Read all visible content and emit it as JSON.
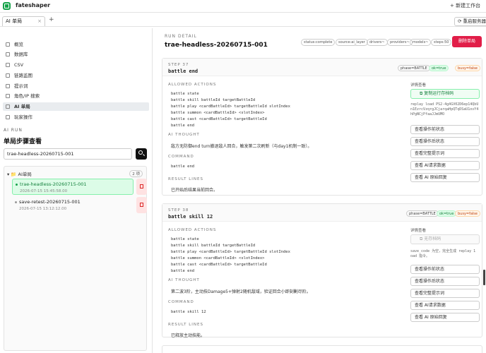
{
  "app": {
    "brand": "fateshaper",
    "new_workspace": "+ 新建工作台"
  },
  "tabs": [
    {
      "label": "AI 单局",
      "close": "×"
    }
  ],
  "tab_add": "+",
  "refresh_label": "重启服务器",
  "sidebar": {
    "items": [
      {
        "label": "概览"
      },
      {
        "label": "数据库"
      },
      {
        "label": "CSV"
      },
      {
        "label": "链路监图"
      },
      {
        "label": "提示词"
      },
      {
        "label": "角色/IP 搜索"
      },
      {
        "label": "AI 单局"
      },
      {
        "label": "玩家操作"
      }
    ],
    "active_index": 6
  },
  "ai_run": {
    "section_label": "AI RUN",
    "title": "单局步骤查看",
    "search_value": "trae-headless-20260715-001",
    "folder": {
      "name": "AI单局",
      "count": "2 项"
    },
    "runs": [
      {
        "name": "trae-headless-20260715-001",
        "time": "2026-07-15 15:45:58.00"
      },
      {
        "name": "save-retest-20260715-001",
        "time": "2026-07-15 13:12:12.00"
      }
    ]
  },
  "run_detail": {
    "section_label": "RUN DETAIL",
    "title": "trae-headless-20260715-001",
    "chips": [
      "status:complete",
      "source:ai_layer",
      "drivers~",
      "providers~",
      "models~",
      "steps:50"
    ],
    "delete_label": "删除单局"
  },
  "labels": {
    "allowed": "ALLOWED ACTIONS",
    "thought": "AI THOUGHT",
    "command": "COMMAND",
    "result": "RESULT LINES",
    "detail": "详情查看",
    "actions": [
      "查看操作前状态",
      "查看操作后状态",
      "查看完整提示词",
      "查看 AI请求数据",
      "查看 AI 原始回复"
    ]
  },
  "steps": [
    {
      "label": "STEP 37",
      "title": "battle end",
      "badges": [
        "phase=BATTLE",
        "ok=true",
        "busy=false"
      ],
      "allowed": [
        "battle state",
        "battle skill battleId targetBattleId",
        "battle play <cardBattleId> targetBattleId slotIndex",
        "battle summon <cardBattleId> <slotIndex>",
        "battle cast <cardBattleId> targetBattleId",
        "battle end"
      ],
      "thought": "敌方无防御end turn撤退敌人回合，触发第二次刷新（与day1机制一致）。",
      "command": "battle end",
      "result": "已开始后结果当前回合。",
      "copy_label": "复制运行存档码",
      "replay": "replay load PS2-4g4GV02D6ep14QbUn1EzrcVzqrgJCjarqaHpQTqDSaU1ovY4hPgNCjPfaaJJmUMO"
    },
    {
      "label": "STEP 38",
      "title": "battle skill 12",
      "badges": [
        "phase=BATTLE",
        "ok=true",
        "busy=false"
      ],
      "allowed": [
        "battle state",
        "battle skill battleId targetBattleId",
        "battle play <cardBattleId> targetBattleId slotIndex",
        "battle summon <cardBattleId> <slotIndex>",
        "battle cast <cardBattleId> targetBattleId",
        "battle end"
      ],
      "thought": "第二波3阶，主动技Damage5+弹射2随机敌域，验证回合小即刻剿尽阶。",
      "command": "battle skill 12",
      "result": "已释放主动技能。",
      "copy_label": "无存档码",
      "replay": "save_code 为空，完全生成 replay 1 oad 指令。"
    }
  ],
  "colors": {
    "accent": "#16a34a",
    "danger": "#e11d48"
  }
}
